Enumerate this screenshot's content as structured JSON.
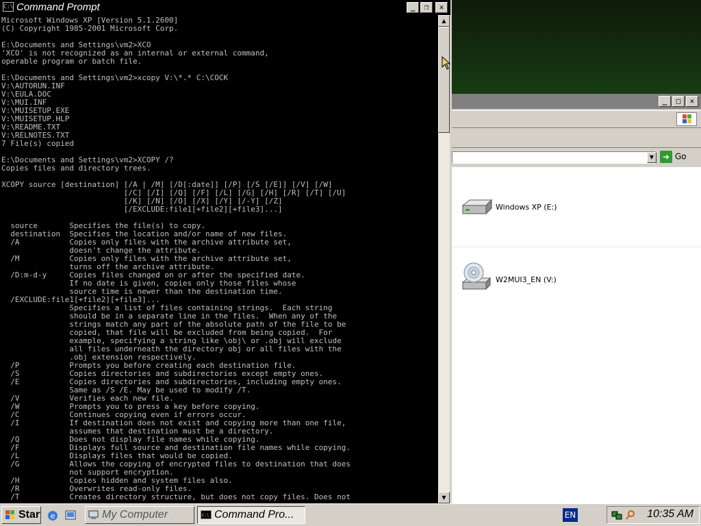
{
  "cmd_window": {
    "title": "Command Prompt",
    "buttons": {
      "minimize": "_",
      "maximize": "❐",
      "close": "✕"
    },
    "console_lines": [
      "Microsoft Windows XP [Version 5.1.2600]",
      "(C) Copyright 1985-2001 Microsoft Corp.",
      "",
      "E:\\Documents and Settings\\vm2>XCO",
      "'XCO' is not recognized as an internal or external command,",
      "operable program or batch file.",
      "",
      "E:\\Documents and Settings\\vm2>xcopy V:\\*.* C:\\COCK",
      "V:\\AUTORUN.INF",
      "V:\\EULA.DOC",
      "V:\\MUI.INF",
      "V:\\MUISETUP.EXE",
      "V:\\MUISETUP.HLP",
      "V:\\README.TXT",
      "V:\\RELNOTES.TXT",
      "7 File(s) copied",
      "",
      "E:\\Documents and Settings\\vm2>XCOPY /?",
      "Copies files and directory trees.",
      "",
      "XCOPY source [destination] [/A | /M] [/D[:date]] [/P] [/S [/E]] [/V] [/W]",
      "                           [/C] [/I] [/Q] [/F] [/L] [/G] [/H] [/R] [/T] [/U]",
      "                           [/K] [/N] [/O] [/X] [/Y] [/-Y] [/Z]",
      "                           [/EXCLUDE:file1[+file2][+file3]...]",
      "",
      "  source       Specifies the file(s) to copy.",
      "  destination  Specifies the location and/or name of new files.",
      "  /A           Copies only files with the archive attribute set,",
      "               doesn't change the attribute.",
      "  /M           Copies only files with the archive attribute set,",
      "               turns off the archive attribute.",
      "  /D:m-d-y     Copies files changed on or after the specified date.",
      "               If no date is given, copies only those files whose",
      "               source time is newer than the destination time.",
      "  /EXCLUDE:file1[+file2][+file3]...",
      "               Specifies a list of files containing strings.  Each string",
      "               should be in a separate line in the files.  When any of the",
      "               strings match any part of the absolute path of the file to be",
      "               copied, that file will be excluded from being copied.  For",
      "               example, specifying a string like \\obj\\ or .obj will exclude",
      "               all files underneath the directory obj or all files with the",
      "               .obj extension respectively.",
      "  /P           Prompts you before creating each destination file.",
      "  /S           Copies directories and subdirectories except empty ones.",
      "  /E           Copies directories and subdirectories, including empty ones.",
      "               Same as /S /E. May be used to modify /T.",
      "  /V           Verifies each new file.",
      "  /W           Prompts you to press a key before copying.",
      "  /C           Continues copying even if errors occur.",
      "  /I           If destination does not exist and copying more than one file,",
      "               assumes that destination must be a directory.",
      "  /Q           Does not display file names while copying.",
      "  /F           Displays full source and destination file names while copying.",
      "  /L           Displays files that would be copied.",
      "  /G           Allows the copying of encrypted files to destination that does",
      "               not support encryption.",
      "  /H           Copies hidden and system files also.",
      "  /R           Overwrites read-only files.",
      "  /T           Creates directory structure, but does not copy files. Does not"
    ]
  },
  "explorer_window": {
    "go_label": "Go",
    "drives": [
      {
        "label": "Windows XP (E:)",
        "icon": "hard-drive-icon"
      },
      {
        "label": "W2MUI3_EN (V:)",
        "icon": "cd-drive-icon"
      }
    ]
  },
  "taskbar": {
    "start_label": "Start",
    "tasks": [
      {
        "label": "My Computer",
        "active": false
      },
      {
        "label": "Command Pro...",
        "active": true
      }
    ],
    "language": "EN",
    "clock": "10:35 AM"
  },
  "colors": {
    "console_bg": "#000000",
    "console_fg": "#c0c0c0",
    "chrome": "#d4d0c8",
    "desktop_green": "#3d9a2d"
  }
}
